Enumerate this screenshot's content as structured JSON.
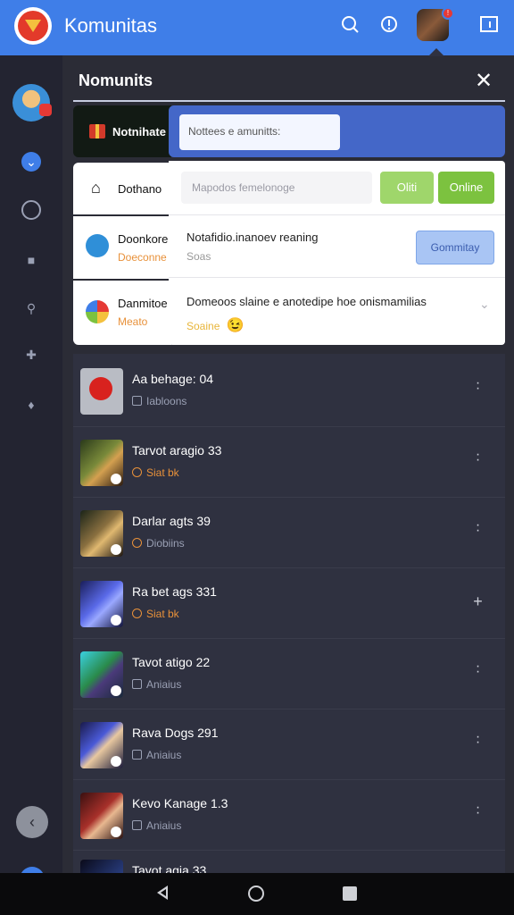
{
  "app": {
    "title": "Komunitas"
  },
  "topbar": {
    "search_icon": "search-icon",
    "info_icon": "info-icon",
    "notif_count": "!",
    "menu_icon": "menu-icon"
  },
  "panel": {
    "title": "Nomunits",
    "close": "✕"
  },
  "left_cards": [
    {
      "label": "Notnihate"
    },
    {
      "label": "Dothano"
    },
    {
      "label": "Doonkore",
      "sub": "Doeconne"
    },
    {
      "label": "Danmitoe",
      "sub": "Meato"
    }
  ],
  "dropdown": {
    "header_input": "Nottees e amunitts:",
    "search_placeholder": "Mapodos femelonoge",
    "btn1": "Oliti",
    "btn2": "Online",
    "line1": "Notafidio.inanoev reaning",
    "line1_sub": "Soas",
    "community_btn": "Gommitay",
    "line2": "Domeoos slaine e anotedipe hoe onismamilias",
    "line2_sub": "Soaine",
    "emoji": "😉"
  },
  "rows": [
    {
      "title": "Aa behage: 04",
      "sub": "Iabloons",
      "sub_color": "grey"
    },
    {
      "title": "Tarvot aragio 33",
      "sub": "Siat bk",
      "sub_color": "orange"
    },
    {
      "title": "Darlar agts 39",
      "sub": "Diobiins",
      "sub_color": "orange"
    },
    {
      "title": "Ra bet ags 331",
      "sub": "Siat bk",
      "sub_color": "orange"
    },
    {
      "title": "Tavot atigo 22",
      "sub": "Aniaius",
      "sub_color": "grey"
    },
    {
      "title": "Rava Dogs 291",
      "sub": "Aniaius",
      "sub_color": "grey"
    },
    {
      "title": "Kevo Kanage 1.3",
      "sub": "Aniaius",
      "sub_color": "grey"
    },
    {
      "title": "Tavot agia 33",
      "sub": "",
      "sub_color": "grey"
    }
  ],
  "colors": {
    "brand": "#3f7ee8",
    "accent_green": "#7cc23f",
    "bg_dark": "#2b2c36"
  }
}
